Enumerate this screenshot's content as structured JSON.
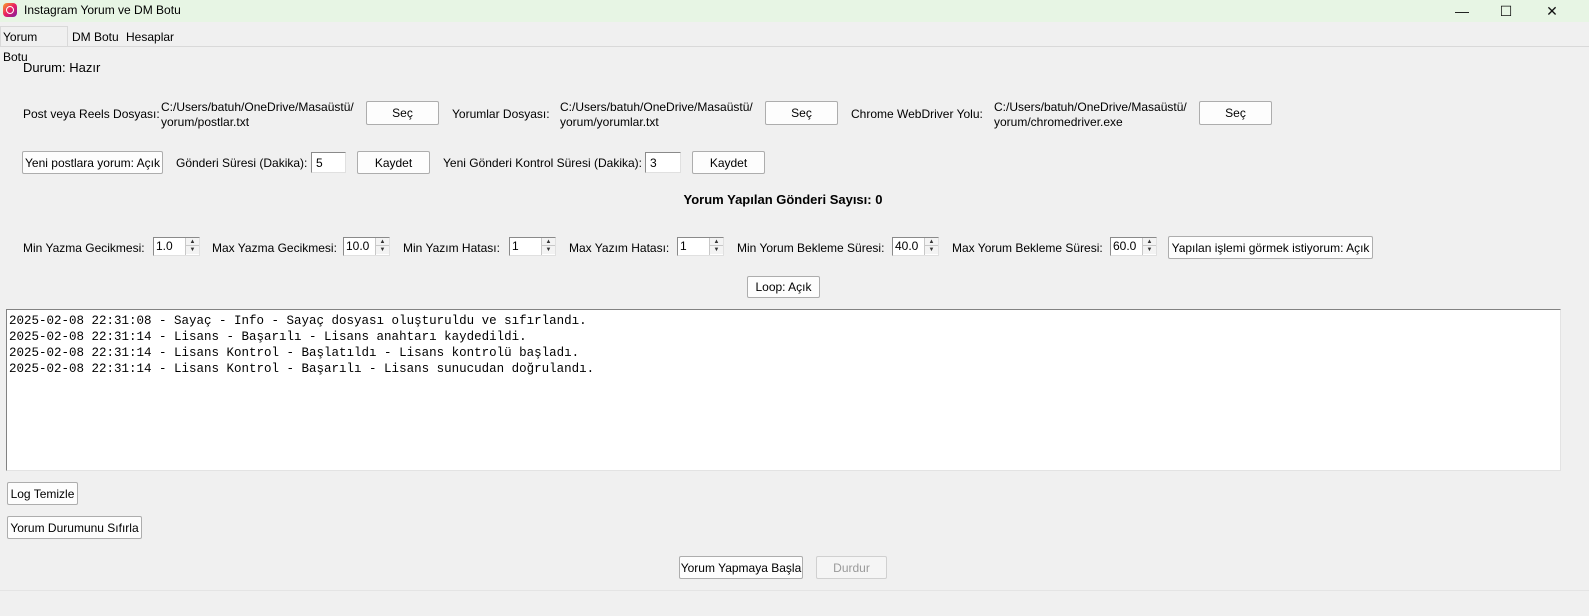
{
  "window": {
    "title": "Instagram Yorum ve DM Botu",
    "minimize_glyph": "—",
    "maximize_glyph": "☐",
    "close_glyph": "✕"
  },
  "tabs": [
    {
      "label": "Yorum Botu",
      "active": true
    },
    {
      "label": "DM Botu",
      "active": false
    },
    {
      "label": "Hesaplar",
      "active": false
    }
  ],
  "status": {
    "text": "Durum: Hazır"
  },
  "files": {
    "post_label": "Post veya Reels Dosyası:",
    "post_path_line1": "C:/Users/batuh/OneDrive/Masaüstü/",
    "post_path_line2": "yorum/postlar.txt",
    "comments_label": "Yorumlar Dosyası:",
    "comments_path_line1": "C:/Users/batuh/OneDrive/Masaüstü/",
    "comments_path_line2": "yorum/yorumlar.txt",
    "driver_label": "Chrome WebDriver Yolu:",
    "driver_path_line1": "C:/Users/batuh/OneDrive/Masaüstü/",
    "driver_path_line2": "yorum/chromedriver.exe",
    "select_label": "Seç"
  },
  "settings": {
    "new_posts_toggle": "Yeni postlara yorum: Açık",
    "post_interval_label": "Gönderi Süresi (Dakika):",
    "post_interval_value": "5",
    "save_label": "Kaydet",
    "check_interval_label": "Yeni Gönderi Kontrol Süresi (Dakika):",
    "check_interval_value": "3"
  },
  "counter": {
    "text": "Yorum Yapılan Gönderi Sayısı: 0"
  },
  "delays": {
    "min_typing_label": "Min Yazma Gecikmesi:",
    "min_typing_value": "1.0",
    "max_typing_label": "Max Yazma Gecikmesi:",
    "max_typing_value": "10.0",
    "min_typo_label": "Min Yazım Hatası:",
    "min_typo_value": "1",
    "max_typo_label": "Max Yazım Hatası:",
    "max_typo_value": "1",
    "min_wait_label": "Min Yorum Bekleme Süresi:",
    "min_wait_value": "40.0",
    "max_wait_label": "Max Yorum Bekleme Süresi:",
    "max_wait_value": "60.0",
    "show_action_toggle": "Yapılan işlemi görmek istiyorum: Açık"
  },
  "loop": {
    "label": "Loop: Açık"
  },
  "log": {
    "lines": [
      "2025-02-08 22:31:08 - Sayaç - Info - Sayaç dosyası oluşturuldu ve sıfırlandı.",
      "2025-02-08 22:31:14 - Lisans - Başarılı - Lisans anahtarı kaydedildi.",
      "2025-02-08 22:31:14 - Lisans Kontrol - Başlatıldı - Lisans kontrolü başladı.",
      "2025-02-08 22:31:14 - Lisans Kontrol - Başarılı - Lisans sunucudan doğrulandı."
    ]
  },
  "actions": {
    "clear_log": "Log Temizle",
    "reset_status": "Yorum Durumunu Sıfırla",
    "start": "Yorum Yapmaya Başla",
    "stop": "Durdur"
  }
}
